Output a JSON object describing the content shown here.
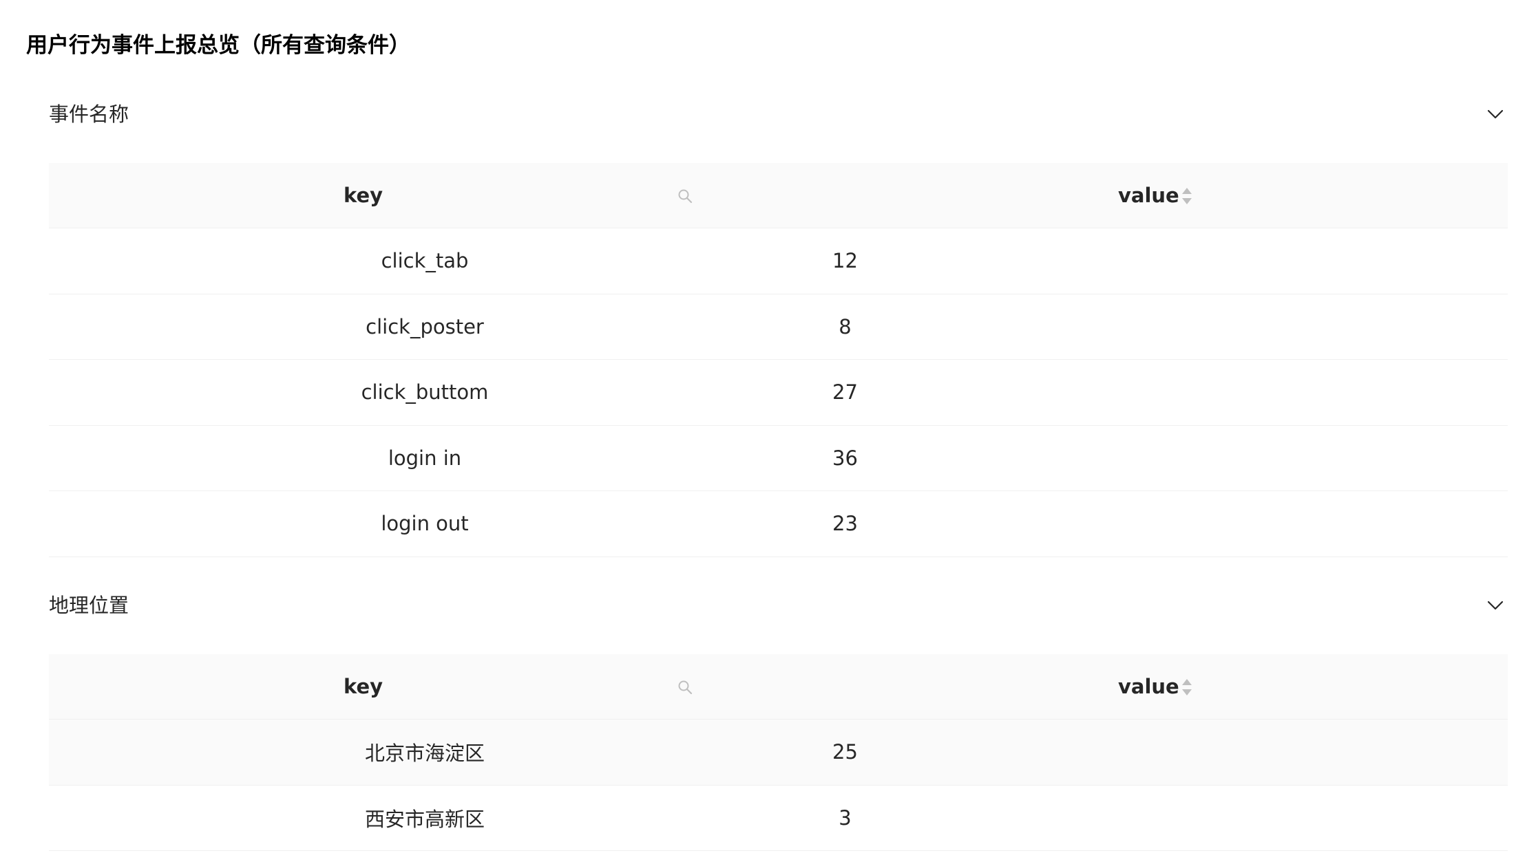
{
  "page": {
    "title": "用户行为事件上报总览（所有查询条件）"
  },
  "sections": [
    {
      "title": "事件名称",
      "toggle_icon": "chevron-down-icon",
      "columns": {
        "key": "key",
        "value": "value"
      },
      "rows": [
        {
          "key": "click_tab",
          "value": "12"
        },
        {
          "key": "click_poster",
          "value": "8"
        },
        {
          "key": "click_buttom",
          "value": "27"
        },
        {
          "key": "login in",
          "value": "36"
        },
        {
          "key": "login out",
          "value": "23"
        }
      ]
    },
    {
      "title": "地理位置",
      "toggle_icon": "chevron-down-icon",
      "columns": {
        "key": "key",
        "value": "value"
      },
      "rows": [
        {
          "key": "北京市海淀区",
          "value": "25"
        },
        {
          "key": "西安市高新区",
          "value": "3"
        }
      ]
    }
  ],
  "icons": {
    "search": "search-icon",
    "sort": "sort-icon",
    "collapse": "chevron-down-icon"
  },
  "colors": {
    "header_bg": "#fafafa",
    "divider": "#f0f0f0",
    "icon_gray": "#bfbfbf"
  }
}
